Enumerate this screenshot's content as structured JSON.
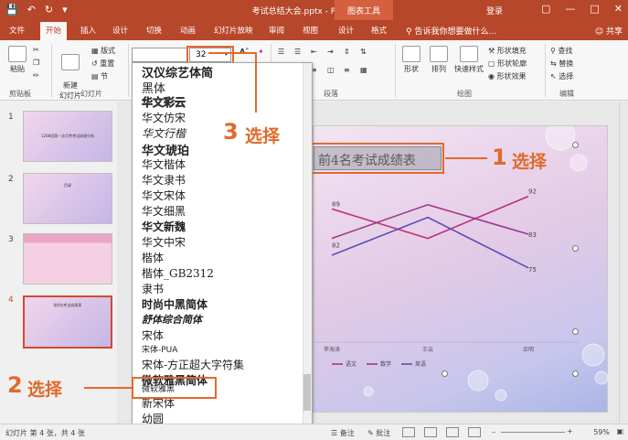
{
  "window": {
    "title": "考试总结大会.pptx - PowerPoint",
    "tool_tab": "图表工具",
    "login": "登录"
  },
  "tabs": [
    {
      "label": "文件"
    },
    {
      "label": "开始",
      "active": true
    },
    {
      "label": "插入"
    },
    {
      "label": "设计"
    },
    {
      "label": "切换"
    },
    {
      "label": "动画"
    },
    {
      "label": "幻灯片放映"
    },
    {
      "label": "审阅"
    },
    {
      "label": "视图"
    },
    {
      "label": "设计"
    },
    {
      "label": "格式"
    }
  ],
  "tell_me": "告诉我你想要做什么...",
  "share": "共享",
  "ribbon": {
    "paste": "粘贴",
    "clipboard": "剪贴板",
    "new_slide": "新建\n幻灯片",
    "layout": "版式",
    "reset": "重置",
    "section": "节",
    "slides_group": "幻灯片",
    "font_size": "32",
    "paragraph_group": "段落",
    "shape": "形状",
    "arrange": "排列",
    "quick_styles": "快速样式",
    "shape_fill": "形状填充",
    "shape_outline": "形状轮廓",
    "shape_effects": "形状效果",
    "drawing_group": "绘图",
    "find": "查找",
    "replace": "替换",
    "select": "选择",
    "editing_group": "编辑"
  },
  "font_list": [
    "汉仪综艺体简",
    "黑体",
    "华文彩云",
    "华文仿宋",
    "华文行楷",
    "华文琥珀",
    "华文楷体",
    "华文隶书",
    "华文宋体",
    "华文细黑",
    "华文新魏",
    "华文中宋",
    "楷体",
    "楷体_GB2312",
    "隶书",
    "时尚中黑简体",
    "舒体综合简体",
    "宋体",
    "宋体-PUA",
    "宋体-方正超大字符集",
    "微软雅黑简体",
    "微软雅黑",
    "新宋体",
    "幼圆"
  ],
  "slides": [
    {
      "number": "1",
      "title": "1208班第一次月考考试成绩分析"
    },
    {
      "number": "2",
      "title": "目录"
    },
    {
      "number": "3",
      "title": ""
    },
    {
      "number": "4",
      "title": "前4名考试成绩表"
    }
  ],
  "slide": {
    "title": "前4名考试成绩表"
  },
  "chart_data": {
    "type": "line",
    "categories": [
      "李海涛",
      "王云",
      "余明"
    ],
    "series": [
      {
        "name": "语文",
        "values": [
          89,
          82,
          92
        ]
      },
      {
        "name": "数学",
        "values": [
          82,
          90,
          83
        ]
      },
      {
        "name": "英语",
        "values": [
          78,
          87,
          75
        ]
      }
    ],
    "data_labels": [
      "89",
      "82",
      "92",
      "83",
      "75"
    ],
    "legend": "bottom"
  },
  "callouts": {
    "one_num": "1",
    "one_text": "选择",
    "two_num": "2",
    "two_text": "选择",
    "three_num": "3",
    "three_text": "选择"
  },
  "status": {
    "slide_info": "幻灯片 第 4 张，共 4 张",
    "notes": "备注",
    "comments": "批注",
    "zoom": "59%"
  },
  "colors": {
    "accent": "#b7472a",
    "callout": "#e16a2a",
    "series_chinese": "#c0307a",
    "series_math": "#9b3a8a",
    "series_english": "#5b4fb4"
  }
}
